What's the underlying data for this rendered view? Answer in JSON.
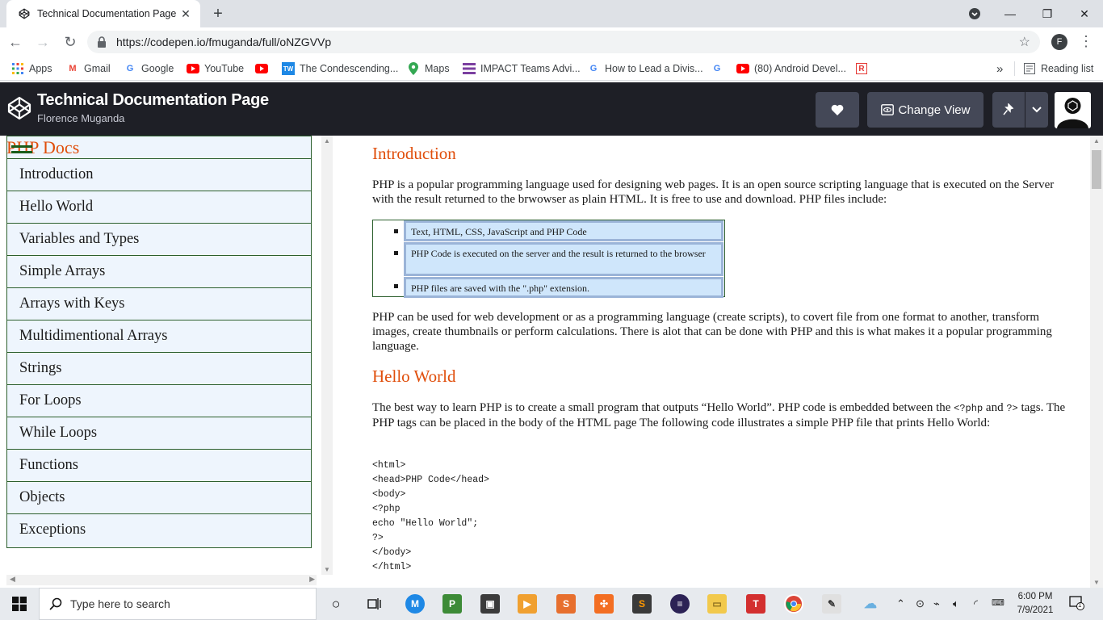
{
  "browser": {
    "tab_title": "Technical Documentation Page",
    "url": "https://codepen.io/fmuganda/full/oNZGVVp",
    "profile_initial": "F",
    "bookmarks": [
      {
        "label": "Apps",
        "icon": "apps-grid-icon"
      },
      {
        "label": "Gmail",
        "icon": "gmail-icon"
      },
      {
        "label": "Google",
        "icon": "google-icon"
      },
      {
        "label": "YouTube",
        "icon": "youtube-icon"
      },
      {
        "label": "",
        "icon": "youtube-icon"
      },
      {
        "label": "The Condescending...",
        "icon": "tw-icon"
      },
      {
        "label": "Maps",
        "icon": "maps-icon"
      },
      {
        "label": "IMPACT Teams Advi...",
        "icon": "impact-icon"
      },
      {
        "label": "How to Lead a Divis...",
        "icon": "google-icon"
      },
      {
        "label": "",
        "icon": "google-icon"
      },
      {
        "label": "(80) Android Devel...",
        "icon": "youtube-icon"
      },
      {
        "label": "",
        "icon": "r-icon"
      }
    ],
    "reading_list": "Reading list",
    "more_bookmarks": "»"
  },
  "codepen": {
    "title": "Technical Documentation Page",
    "author": "Florence Muganda",
    "change_view": "Change View"
  },
  "sidebar": {
    "title": "PHP Docs",
    "items": [
      "Introduction",
      "Hello World",
      "Variables and Types",
      "Simple Arrays",
      "Arrays with Keys",
      "Multidimentional Arrays",
      "Strings",
      "For Loops",
      "While Loops",
      "Functions",
      "Objects",
      "Exceptions"
    ]
  },
  "main": {
    "intro_heading": "Introduction",
    "intro_p1": "PHP is a popular programming language used for designing web pages. It is an open source scripting language that is executed on the Server with the result returned to the brwowser as plain HTML. It is free to use and download. PHP files include:",
    "features": [
      "Text, HTML, CSS, JavaScript and PHP Code",
      "PHP Code is executed on the server and the result is returned to the browser",
      "PHP files are saved with the \".php\" extension."
    ],
    "intro_p2": "PHP can be used for web development or as a programming language (create scripts), to covert file from one format to another, transform images, create thumbnails or perform calculations. There is alot that can be done with PHP and this is what makes it a popular programming language.",
    "hello_heading": "Hello World",
    "hello_p1a": "The best way to learn PHP is to create a small program that outputs “Hello World”. PHP code is embedded between the ",
    "hello_code1": "<?php",
    "hello_and": " and ",
    "hello_code2": "?>",
    "hello_p1b": " tags. The PHP tags can be placed in the body of the HTML page The following code illustrates a simple PHP file that prints Hello World:",
    "code_lines": [
      "<html>",
      "<head>PHP Code</head>",
      "<body>",
      "<?php",
      "echo \"Hello World\";",
      "?>",
      "</body>",
      "</html>"
    ]
  },
  "taskbar": {
    "search_placeholder": "Type here to search",
    "time": "6:00 PM",
    "date": "7/9/2021",
    "notification_count": "1"
  }
}
